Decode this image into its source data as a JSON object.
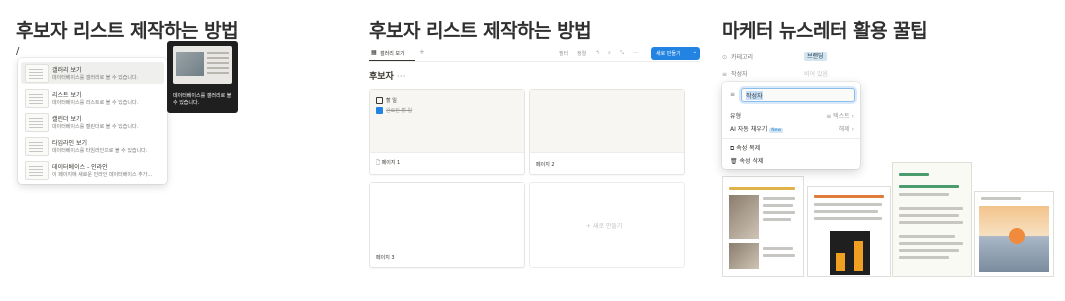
{
  "panel1": {
    "title": "후보자 리스트 제작하는 방법",
    "slash": "/",
    "menu": [
      {
        "name": "갤러리 보기",
        "desc": "데이터베이스를 갤러리로 볼 수 있습니다."
      },
      {
        "name": "리스트 보기",
        "desc": "데이터베이스를 리스트로 볼 수 있습니다."
      },
      {
        "name": "캘린더 보기",
        "desc": "데이터베이스를 캘린더로 볼 수 있습니다."
      },
      {
        "name": "타임라인 보기",
        "desc": "데이터베이스를 타임라인으로 볼 수 있습니다."
      },
      {
        "name": "데이터베이스 - 인라인",
        "desc": "이 페이지에 새로운 인라인 데이터베이스 추가..."
      }
    ],
    "preview_text": "데이터베이스를 갤러리로 볼 수 있습니다."
  },
  "panel2": {
    "title": "후보자 리스트 제작하는 방법",
    "tab_label": "갤러리 보기",
    "tab_add": "+",
    "toolbar": {
      "filter": "필터",
      "sort": "정렬",
      "new_button": "새로 만들기"
    },
    "group_name": "후보자",
    "group_more": "···",
    "cards": [
      {
        "name": "페이지 1",
        "todos": [
          {
            "text": "할 일",
            "done": false
          },
          {
            "text": "완료된 할 일",
            "done": true
          }
        ]
      },
      {
        "name": "페이지 2",
        "todos": []
      },
      {
        "name": "페이지 3",
        "todos": []
      }
    ],
    "new_card": "+ 새로 만들기"
  },
  "panel3": {
    "title": "마케터 뉴스레터 활용 꿀팁",
    "properties": [
      {
        "icon": "category-icon",
        "label": "카테고리",
        "value": "브랜딩",
        "tag": true
      },
      {
        "icon": "text-icon",
        "label": "작성자",
        "value": "비어 있음",
        "tag": false
      }
    ],
    "popup": {
      "input_value": "작성자",
      "type_label": "유형",
      "type_value": "텍스트",
      "autofill_label": "AI 자동 채우기",
      "autofill_badge": "New",
      "autofill_value": "해제",
      "duplicate": "속성 복제",
      "delete": "속성 삭제"
    }
  }
}
